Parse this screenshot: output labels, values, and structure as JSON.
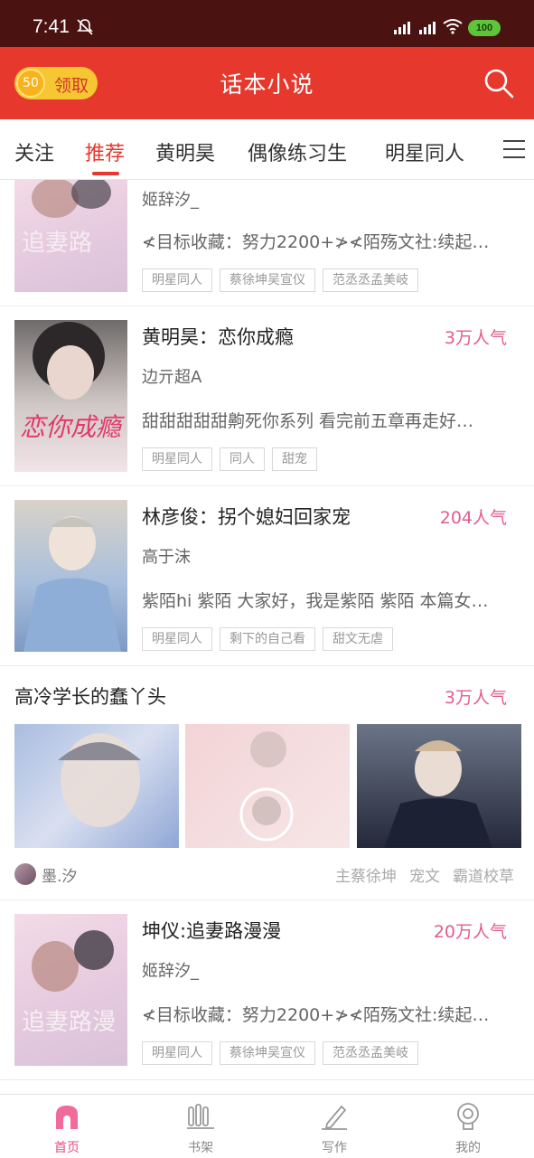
{
  "status_bar": {
    "time": "7:41",
    "battery": "100"
  },
  "header": {
    "coin_value": "50",
    "coin_label": "领取",
    "title": "话本小说"
  },
  "tabs": [
    "关注",
    "推荐",
    "黄明昊",
    "偶像练习生",
    "明星同人"
  ],
  "active_tab": "推荐",
  "cards": [
    {
      "title": "",
      "popularity": "",
      "author": "姬辞汐_",
      "description": "≮目标收藏：努力2200+≯≮陌殇文社:续起…",
      "tags": [
        "明星同人",
        "蔡徐坤吴宣仪",
        "范丞丞孟美岐"
      ]
    },
    {
      "title": "黄明昊：恋你成瘾",
      "popularity": "3万人气",
      "author": "边亓超A",
      "description": "甜甜甜甜甜齁死你系列 看完前五章再走好…",
      "tags": [
        "明星同人",
        "同人",
        "甜宠"
      ]
    },
    {
      "title": "林彦俊：拐个媳妇回家宠",
      "popularity": "204人气",
      "author": "高于沫",
      "description": "紫陌hi 紫陌 大家好，我是紫陌 紫陌 本篇女…",
      "tags": [
        "明星同人",
        "剩下的自己看",
        "甜文无虐"
      ]
    }
  ],
  "album": {
    "title": "高冷学长的蠢丫头",
    "popularity": "3万人气",
    "author": "墨.汐",
    "tags": [
      "主蔡徐坤",
      "宠文",
      "霸道校草"
    ]
  },
  "card_last": {
    "title": "坤仪:追妻路漫漫",
    "popularity": "20万人气",
    "author": "姬辞汐_",
    "description": "≮目标收藏：努力2200+≯≮陌殇文社:续起…",
    "tags": [
      "明星同人",
      "蔡徐坤吴宣仪",
      "范丞丞孟美岐"
    ]
  },
  "bottom_nav": [
    {
      "label": "首页",
      "icon": "home-icon"
    },
    {
      "label": "书架",
      "icon": "bookshelf-icon"
    },
    {
      "label": "写作",
      "icon": "write-pen-icon"
    },
    {
      "label": "我的",
      "icon": "profile-icon"
    }
  ],
  "colors": {
    "header": "#e6382d",
    "status_bar": "#4a1210",
    "popularity": "#e35c8e",
    "nav_active": "#e2507f"
  }
}
